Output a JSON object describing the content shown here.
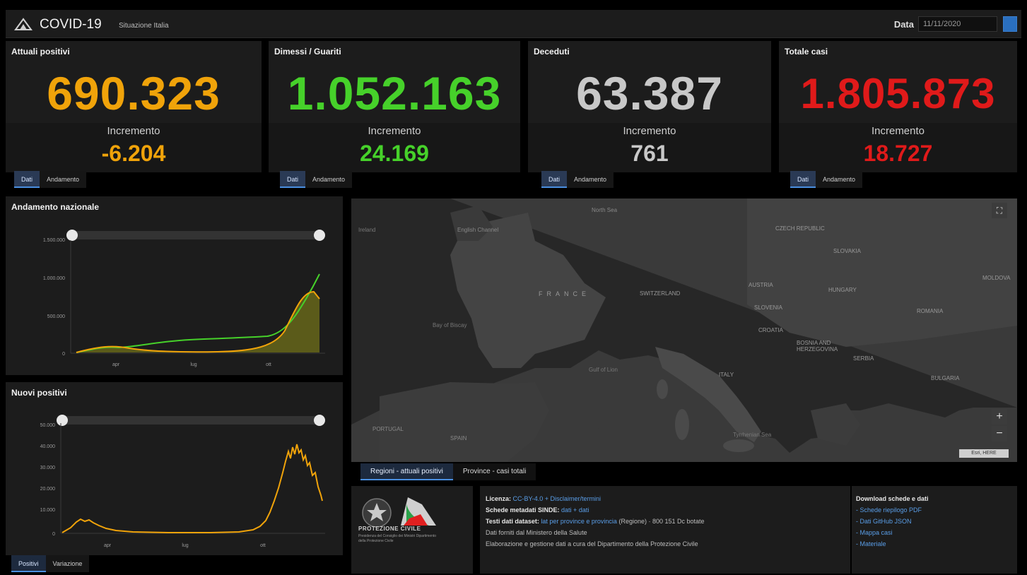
{
  "header": {
    "title": "COVID-19",
    "subtitle": "Situazione Italia",
    "date_label": "Data",
    "date_value": "11/11/2020",
    "accent_color": "#2a6fbf"
  },
  "cards": [
    {
      "title": "Attuali positivi",
      "value": "690.323",
      "inc_label": "Incremento",
      "inc_value": "-6.204",
      "color": "#f0a30a",
      "tabs": [
        "Dati",
        "Andamento"
      ]
    },
    {
      "title": "Dimessi / Guariti",
      "value": "1.052.163",
      "inc_label": "Incremento",
      "inc_value": "24.169",
      "color": "#46d12a",
      "tabs": [
        "Dati",
        "Andamento"
      ]
    },
    {
      "title": "Deceduti",
      "value": "63.387",
      "inc_label": "Incremento",
      "inc_value": "761",
      "color": "#c8c8c8",
      "tabs": [
        "Dati",
        "Andamento"
      ]
    },
    {
      "title": "Totale casi",
      "value": "1.805.873",
      "inc_label": "Incremento",
      "inc_value": "18.727",
      "color": "#e01a1a",
      "tabs": [
        "Dati",
        "Andamento"
      ]
    }
  ],
  "national_trend": {
    "title": "Andamento nazionale",
    "y_ticks": [
      "1.500.000",
      "1.000.000",
      "500.000",
      "0"
    ],
    "x_ticks": [
      "apr",
      "lug",
      "ott"
    ]
  },
  "new_positives": {
    "title": "Nuovi positivi",
    "y_ticks": [
      "50.000",
      "40.000",
      "30.000",
      "20.000",
      "10.000",
      "0"
    ],
    "x_ticks": [
      "apr",
      "lug",
      "ott"
    ],
    "tabs": [
      "Positivi",
      "Variazione"
    ]
  },
  "map": {
    "labels": [
      "Ireland",
      "FRANCE",
      "SWITZERLAND",
      "AUSTRIA",
      "CZECH REPUBLIC",
      "SLOVAKIA",
      "HUNGARY",
      "CROATIA",
      "BOSNIA AND HERZEGOVINA",
      "SERBIA",
      "ROMANIA",
      "ITALY",
      "PORTUGAL",
      "SPAIN",
      "Bay of Biscay",
      "Gulf of Lion",
      "Tyrrhenian Sea",
      "MOLDOVA",
      "BULGARIA",
      "SLOVENIA",
      "North Sea",
      "English Channel"
    ],
    "zoom_in": "+",
    "zoom_out": "−",
    "scale_text": "Esri, HERE"
  },
  "bottom_tabs": [
    "Regioni - attuali positivi",
    "Province - casi totali"
  ],
  "info": {
    "logo_text": "PROTEZIONE CIVILE",
    "logo_sub": "Presidenza del Consiglio dei Ministri Dipartimento della Protezione Civile",
    "lines": [
      {
        "label": "Licenza:",
        "value": "CC-BY-4.0 + Disclaimer/termini"
      },
      {
        "label": "Schede metadati SINDE:",
        "value": "dati + dati"
      },
      {
        "label": "Testi dati dataset:",
        "value": "lat per province e provincia",
        "suffix": "(Regione) · 800 151 Dc botate"
      },
      {
        "label": "",
        "value": "",
        "suffix": "Dati forniti dal Ministero della Salute"
      },
      {
        "label": "",
        "value": "",
        "suffix": "Elaborazione e gestione dati a cura del Dipartimento della Protezione Civile"
      }
    ],
    "download_title": "Download schede e dati",
    "download_links": [
      "- Schede riepilogo PDF",
      "- Dati GitHub JSON",
      "- Mappa casi",
      "- Materiale"
    ]
  }
}
